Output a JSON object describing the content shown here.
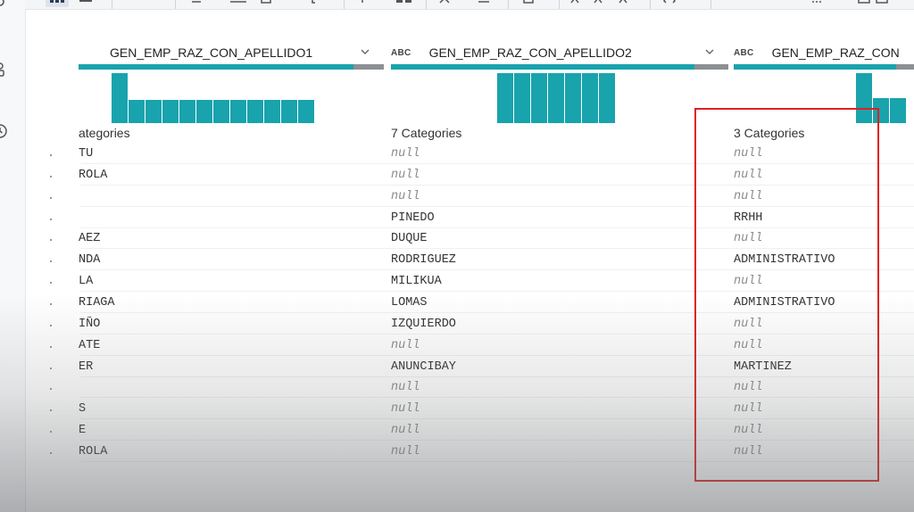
{
  "columns": [
    {
      "name": "GEN_EMP_RAZ_CON_APELLIDO1",
      "type": "",
      "categories": "ategories",
      "dist": [
        1.0,
        0.46,
        0.46,
        0.46,
        0.46,
        0.46,
        0.46,
        0.46,
        0.46,
        0.46,
        0.46,
        0.46
      ],
      "valid_fraction": 0.9
    },
    {
      "name": "GEN_EMP_RAZ_CON_APELLIDO2",
      "type": "ABC",
      "categories": "7 Categories",
      "dist": [
        1,
        1,
        1,
        1,
        1,
        1,
        1
      ],
      "valid_fraction": 0.9
    },
    {
      "name": "GEN_EMP_RAZ_CON",
      "type": "ABC",
      "categories": "3 Categories",
      "dist": [
        1.0,
        0.5,
        0.5
      ],
      "valid_fraction": 0.9
    }
  ],
  "rows": [
    [
      "TU",
      "null",
      "null"
    ],
    [
      "ROLA",
      "null",
      "null"
    ],
    [
      "",
      "null",
      "null"
    ],
    [
      "",
      "PINEDO",
      "RRHH"
    ],
    [
      "AEZ",
      "DUQUE",
      "null"
    ],
    [
      "NDA",
      "RODRIGUEZ",
      "ADMINISTRATIVO"
    ],
    [
      "LA",
      "MILIKUA",
      "null"
    ],
    [
      "RIAGA",
      "LOMAS",
      "ADMINISTRATIVO"
    ],
    [
      "IÑO",
      "IZQUIERDO",
      "null"
    ],
    [
      "ATE",
      "null",
      "null"
    ],
    [
      "ER",
      "ANUNCIBAY",
      "MARTINEZ"
    ],
    [
      "",
      "null",
      "null"
    ],
    [
      "S",
      "null",
      "null"
    ],
    [
      "E",
      "null",
      "null"
    ],
    [
      "ROLA",
      "null",
      "null"
    ]
  ],
  "colors": {
    "accent": "#18a3ad",
    "missing": "#8c8f93",
    "highlight": "#e02020"
  },
  "icons": [
    "settings-icon",
    "share-icon",
    "history-icon",
    "grid-view-icon",
    "chevron-down-icon"
  ]
}
